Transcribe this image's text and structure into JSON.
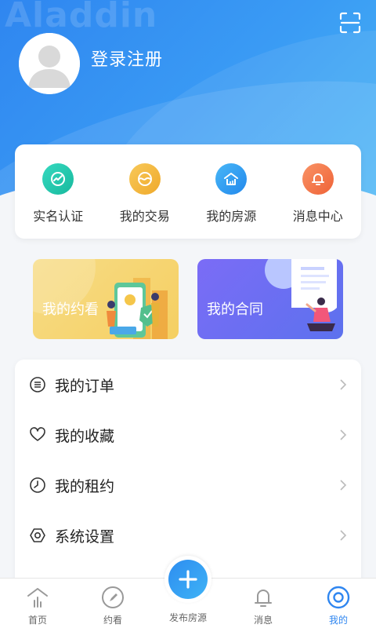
{
  "header": {
    "watermark": "Aladdin",
    "login_label": "登录注册",
    "scan_icon": "scan-icon"
  },
  "quick_actions": [
    {
      "label": "实名认证",
      "icon": "verify-icon",
      "color": "#22c9b0"
    },
    {
      "label": "我的交易",
      "icon": "trade-icon",
      "color": "#f4b73c"
    },
    {
      "label": "我的房源",
      "icon": "house-icon",
      "color": "#2d9ff2"
    },
    {
      "label": "消息中心",
      "icon": "bell-icon",
      "color": "#f3784a"
    }
  ],
  "banners": [
    {
      "label": "我的约看",
      "color": "#f6d66c"
    },
    {
      "label": "我的合同",
      "color": "#6e6ff4"
    }
  ],
  "menu": [
    {
      "label": "我的订单",
      "icon": "order-icon"
    },
    {
      "label": "我的收藏",
      "icon": "heart-icon"
    },
    {
      "label": "我的租约",
      "icon": "clock-icon"
    },
    {
      "label": "系统设置",
      "icon": "settings-icon"
    }
  ],
  "tabbar": {
    "items": [
      {
        "label": "首页",
        "icon": "home-icon"
      },
      {
        "label": "约看",
        "icon": "compass-icon"
      },
      {
        "label": "发布房源",
        "icon": "plus-icon"
      },
      {
        "label": "消息",
        "icon": "bell-icon"
      },
      {
        "label": "我的",
        "icon": "profile-icon"
      }
    ],
    "active": "我的",
    "accent": "#2f86f0"
  }
}
